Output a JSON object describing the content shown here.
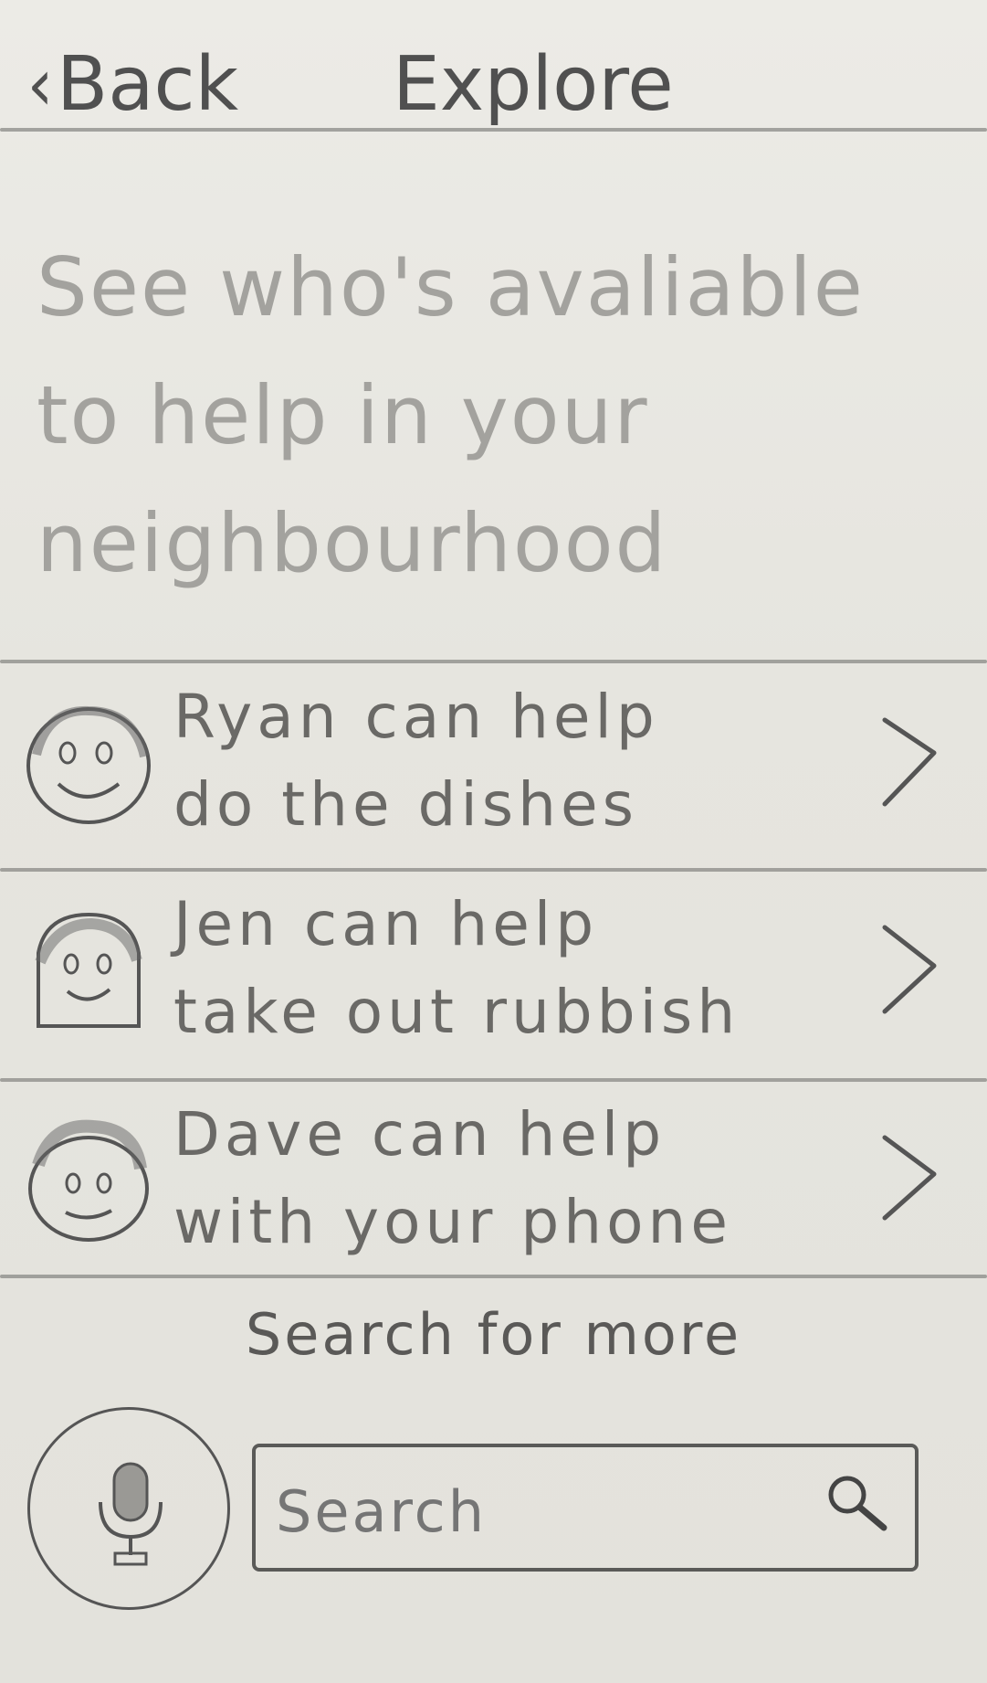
{
  "header": {
    "back_label": "Back",
    "back_icon": "chevron-left-icon",
    "title": "Explore"
  },
  "intro": {
    "text": "See who's avaliable to help in your neighbourhood"
  },
  "helpers": [
    {
      "line1": "Ryan can help",
      "line2": "do the dishes",
      "avatar_icon": "smiley-face-icon",
      "chevron_icon": "chevron-right-icon"
    },
    {
      "line1": "Jen can help",
      "line2": "take out rubbish",
      "avatar_icon": "smiley-face-icon",
      "chevron_icon": "chevron-right-icon"
    },
    {
      "line1": "Dave can help",
      "line2": "with your phone",
      "avatar_icon": "smiley-face-icon",
      "chevron_icon": "chevron-right-icon"
    }
  ],
  "search": {
    "heading": "Search for more",
    "placeholder": "Search",
    "mic_icon": "microphone-icon",
    "search_icon": "magnifier-icon"
  },
  "colors": {
    "paper": "#e9e8e3",
    "pencil": "#4a4a48",
    "faint_pencil": "#a3a29e"
  }
}
